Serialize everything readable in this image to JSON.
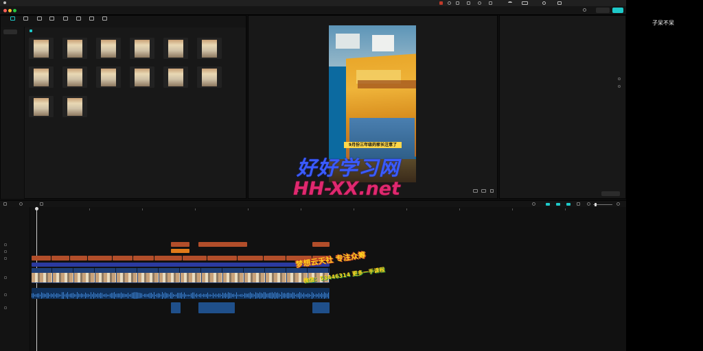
{
  "menubar": {
    "app_name": "",
    "menu_items": [
      "",
      "",
      ""
    ],
    "clock": ""
  },
  "window": {
    "title": "",
    "right_button_1": "",
    "right_button_2": ""
  },
  "toolbar_tabs": [
    {
      "label": "",
      "icon": "media-icon"
    },
    {
      "label": "",
      "icon": "audio-icon"
    },
    {
      "label": "",
      "icon": "text-icon"
    },
    {
      "label": "",
      "icon": "sticker-icon"
    },
    {
      "label": "",
      "icon": "effects-icon"
    },
    {
      "label": "",
      "icon": "transition-icon"
    },
    {
      "label": "",
      "icon": "filter-icon"
    },
    {
      "label": "",
      "icon": "adjust-icon"
    }
  ],
  "media_sidebar": {
    "items": [
      "",
      "",
      ""
    ]
  },
  "media_header": {
    "import_label": "",
    "sort_label": ""
  },
  "media_items": [
    {
      "dur": "",
      "name": ""
    },
    {
      "dur": "",
      "name": ""
    },
    {
      "dur": "",
      "name": ""
    },
    {
      "dur": "",
      "name": ""
    },
    {
      "dur": "",
      "name": ""
    },
    {
      "dur": "",
      "name": ""
    },
    {
      "dur": "",
      "name": ""
    },
    {
      "dur": "",
      "name": ""
    },
    {
      "dur": "",
      "name": ""
    },
    {
      "dur": "",
      "name": ""
    },
    {
      "dur": "",
      "name": ""
    },
    {
      "dur": "",
      "name": ""
    },
    {
      "dur": "",
      "name": ""
    },
    {
      "dur": "",
      "name": ""
    }
  ],
  "player": {
    "title": "",
    "subtitle_caption": "9月份三年级的家长注意了",
    "time_current": "",
    "time_total": ""
  },
  "properties": {
    "title": "",
    "rows": [
      {
        "label": "",
        "value": ""
      },
      {
        "label": "",
        "value": ""
      },
      {
        "label": "",
        "value": ""
      },
      {
        "label": "",
        "value": ""
      },
      {
        "label": "",
        "value": ""
      },
      {
        "label": "",
        "value": ""
      },
      {
        "label": "",
        "value": ""
      },
      {
        "label": "",
        "value": ""
      }
    ],
    "modify_button": ""
  },
  "timeline": {
    "ruler_ticks": [
      "",
      "",
      "",
      "",
      "",
      "",
      "",
      "",
      "",
      "",
      ""
    ],
    "cover_label": "",
    "text_clips": [
      "",
      "",
      "",
      "",
      "",
      "",
      "",
      "",
      "",
      "",
      "",
      "",
      "",
      ""
    ],
    "upper_clips": [
      "",
      "",
      ""
    ],
    "video_clips": [
      "",
      "",
      "",
      "",
      "",
      "",
      "",
      "",
      "",
      "",
      "",
      "",
      "",
      ""
    ],
    "audio_label": "",
    "bottom_clips": [
      "",
      "",
      ""
    ]
  },
  "colors": {
    "accent": "#1ec9c9",
    "clip_orange": "#b24e2a",
    "clip_blue": "#2b3aa0"
  },
  "overlays": {
    "side_text": "子呆不呆",
    "watermark_cn": "好好学习网",
    "watermark_en": "HH-XX.net",
    "promo_line1": "梦想云天社   专注众筹",
    "promo_line2": "",
    "promo_line3": "微信：53446314  更多一手课程"
  }
}
